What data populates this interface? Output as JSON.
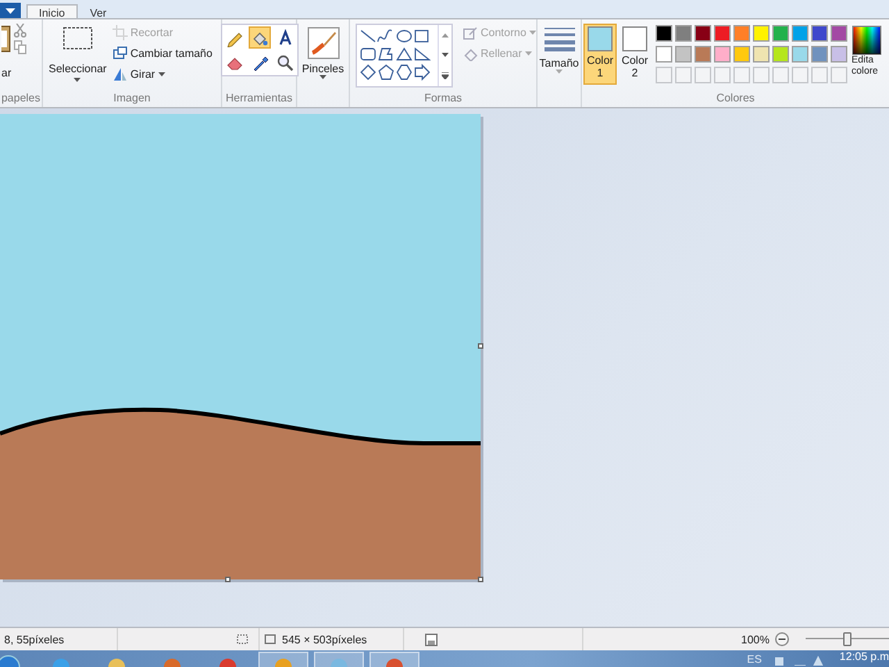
{
  "tabs": [
    {
      "label": "Inicio",
      "selected": true
    },
    {
      "label": "Ver",
      "selected": false
    }
  ],
  "ribbon": {
    "groups": [
      {
        "kind": "clipboard",
        "label": "papeles",
        "paste_label": "ar"
      },
      {
        "kind": "image",
        "label": "Imagen",
        "select_label": "Seleccionar",
        "actions": [
          {
            "kind": "crop",
            "label": "Recortar",
            "disabled": true
          },
          {
            "kind": "resize",
            "label": "Cambiar tamaño",
            "disabled": false
          },
          {
            "kind": "rotate",
            "label": "Girar",
            "disabled": false
          }
        ]
      },
      {
        "kind": "tools",
        "label": "Herramientas",
        "tools": [
          {
            "kind": "pencil",
            "selected": false
          },
          {
            "kind": "fill",
            "selected": true
          },
          {
            "kind": "text",
            "selected": false
          },
          {
            "kind": "eraser",
            "selected": false
          },
          {
            "kind": "picker",
            "selected": false
          },
          {
            "kind": "magnifier",
            "selected": false
          }
        ]
      },
      {
        "kind": "brushes",
        "label": "Pinceles"
      },
      {
        "kind": "shapes",
        "label": "Formas",
        "outline": {
          "label": "Contorno",
          "disabled": true
        },
        "fill": {
          "label": "Rellenar",
          "disabled": true
        }
      },
      {
        "kind": "size",
        "label": "Tamaño",
        "disabled": true
      },
      {
        "kind": "colors",
        "label": "Colores",
        "edit_label": "Edita colore",
        "slots": [
          {
            "label": "Color 1",
            "color": "#99d9ea",
            "selected": true
          },
          {
            "label": "Color 2",
            "color": "#ffffff",
            "selected": false
          }
        ],
        "palette": [
          {
            "color": "#000000"
          },
          {
            "color": "#7f7f7f"
          },
          {
            "color": "#880015"
          },
          {
            "color": "#ed1c24"
          },
          {
            "color": "#ff7f27"
          },
          {
            "color": "#fff200"
          },
          {
            "color": "#22b14c"
          },
          {
            "color": "#00a2e8"
          },
          {
            "color": "#3f48cc"
          },
          {
            "color": "#a349a4"
          },
          {
            "color": "#ffffff"
          },
          {
            "color": "#c3c3c3"
          },
          {
            "color": "#b97a57"
          },
          {
            "color": "#ffaec9"
          },
          {
            "color": "#ffc90e"
          },
          {
            "color": "#efe4b0"
          },
          {
            "color": "#b5e61d"
          },
          {
            "color": "#99d9ea"
          },
          {
            "color": "#7092be"
          },
          {
            "color": "#c8bfe7"
          }
        ]
      }
    ]
  },
  "status_bar": {
    "cursor": "8, 55píxeles",
    "size": "545 × 503píxeles",
    "zoom": "100%",
    "zoom_slider": {
      "level": 0.5
    }
  },
  "taskbar": {
    "language": "ES",
    "clock": "12:05 p.m"
  }
}
